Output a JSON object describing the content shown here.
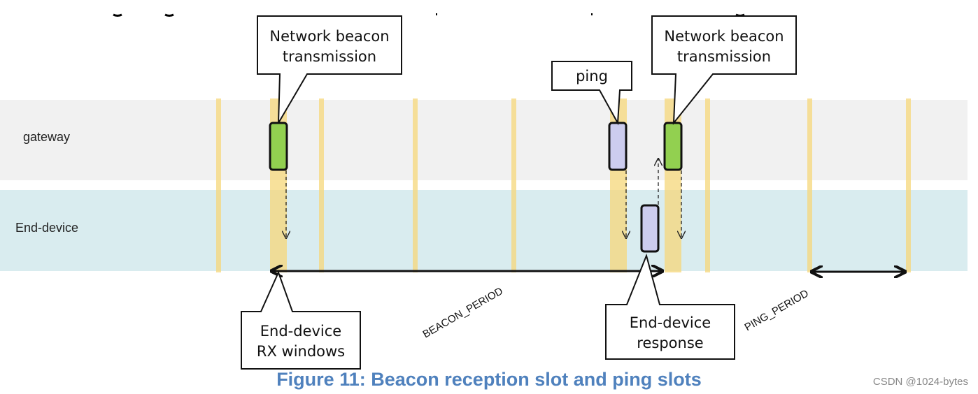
{
  "lanes": {
    "gateway": "gateway",
    "end_device": "End-device"
  },
  "callouts": {
    "beacon_1": [
      "Network beacon",
      "transmission"
    ],
    "beacon_2": [
      "Network beacon",
      "transmission"
    ],
    "ping": [
      "ping"
    ],
    "rx_windows": [
      "End-device",
      "RX windows"
    ],
    "response": [
      "End-device",
      "response"
    ]
  },
  "periods": {
    "beacon": "BEACON_PERIOD",
    "ping": "PING_PERIOD"
  },
  "caption": "Figure 11: Beacon reception slot and ping slots",
  "watermark": "CSDN @1024-bytes",
  "colors": {
    "gateway_lane": "#f1f1f1",
    "end_device_lane": "#d9ecef",
    "slot": "#f5d77a",
    "beacon_block": "#92d050",
    "ping_block": "#ccccee"
  }
}
